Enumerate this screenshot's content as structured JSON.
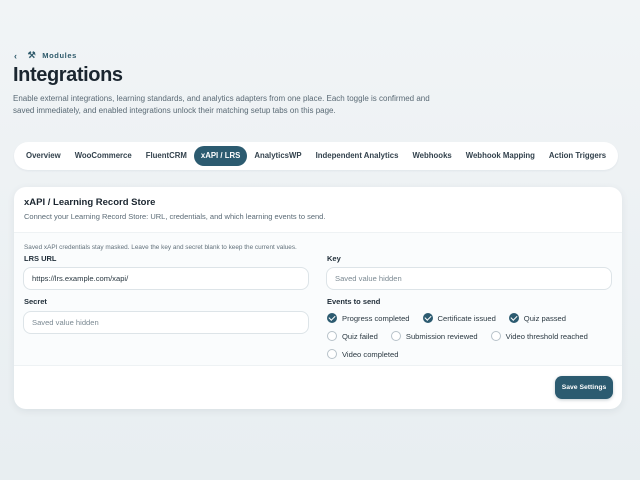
{
  "breadcrumb": {
    "back_icon": "chevron-left-icon",
    "section_icon": "tools-icon",
    "label": "Modules"
  },
  "page": {
    "title": "Integrations",
    "description": "Enable external integrations, learning standards, and analytics adapters from one place. Each toggle is confirmed and saved immediately, and enabled integrations unlock their matching setup tabs on this page."
  },
  "tabs": [
    {
      "label": "Overview",
      "active": false
    },
    {
      "label": "WooCommerce",
      "active": false
    },
    {
      "label": "FluentCRM",
      "active": false
    },
    {
      "label": "xAPI / LRS",
      "active": true
    },
    {
      "label": "AnalyticsWP",
      "active": false
    },
    {
      "label": "Independent Analytics",
      "active": false
    },
    {
      "label": "Webhooks",
      "active": false
    },
    {
      "label": "Webhook Mapping",
      "active": false
    },
    {
      "label": "Action Triggers",
      "active": false
    }
  ],
  "card": {
    "title": "xAPI / Learning Record Store",
    "subtitle": "Connect your Learning Record Store: URL, credentials, and which learning events to send.",
    "notice": "Saved xAPI credentials stay masked. Leave the key and secret blank to keep the current values.",
    "fields": {
      "lrs_url": {
        "label": "LRS URL",
        "value": "https://lrs.example.com/xapi/",
        "placeholder": ""
      },
      "key": {
        "label": "Key",
        "value": "",
        "placeholder": "Saved value hidden"
      },
      "secret": {
        "label": "Secret",
        "value": "",
        "placeholder": "Saved value hidden"
      }
    },
    "events_label": "Events to send",
    "events": [
      {
        "label": "Progress completed",
        "checked": true
      },
      {
        "label": "Certificate issued",
        "checked": true
      },
      {
        "label": "Quiz passed",
        "checked": true
      },
      {
        "label": "Quiz failed",
        "checked": false
      },
      {
        "label": "Submission reviewed",
        "checked": false
      },
      {
        "label": "Video threshold reached",
        "checked": false
      },
      {
        "label": "Video completed",
        "checked": false
      }
    ],
    "save_label": "Save Settings"
  },
  "colors": {
    "accent": "#2c5b70",
    "background": "#eef2f4",
    "card": "#ffffff"
  }
}
